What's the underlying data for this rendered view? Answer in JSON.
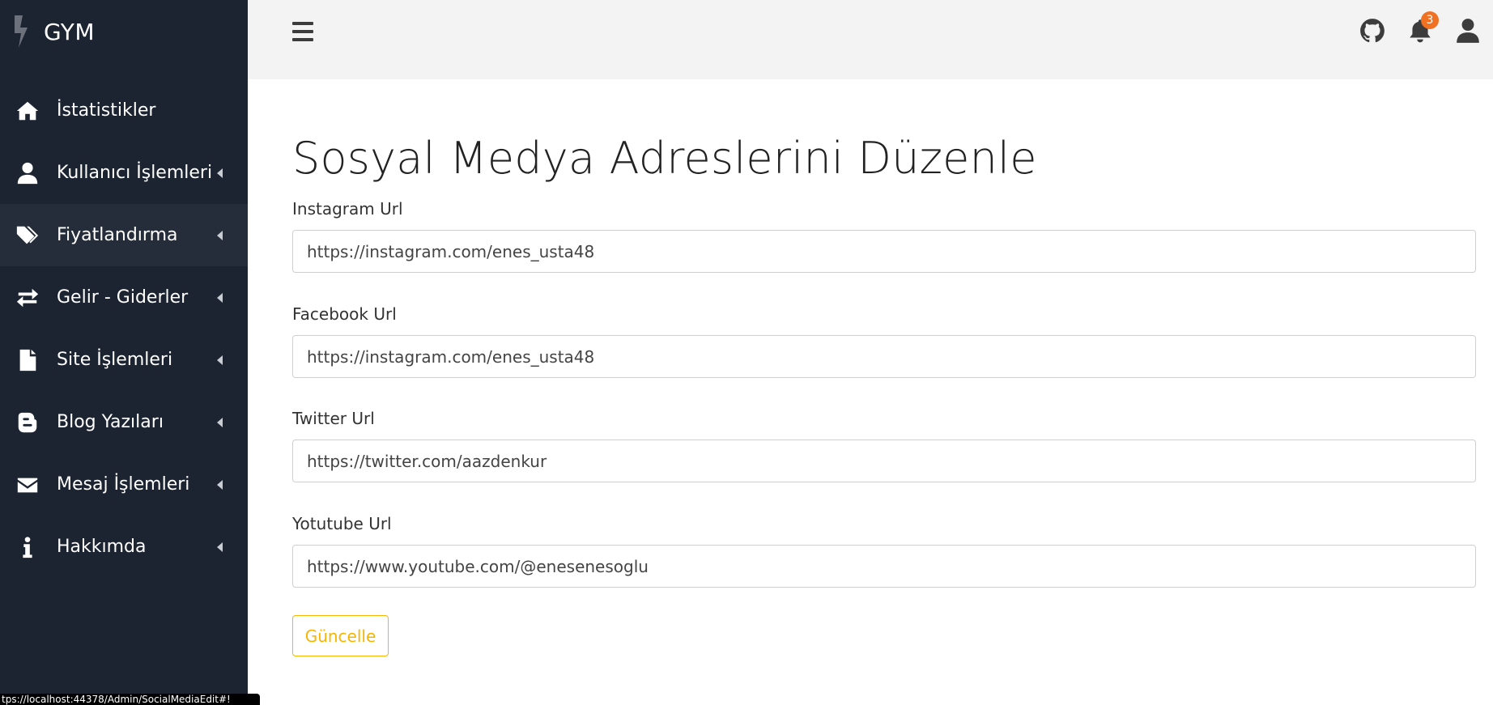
{
  "brand": {
    "name": "GYM",
    "icon": "bolt-icon"
  },
  "sidebar": {
    "items": [
      {
        "label": "İstatistikler",
        "icon": "home-icon",
        "has_caret": false
      },
      {
        "label": "Kullanıcı İşlemleri",
        "icon": "user-icon",
        "has_caret": true
      },
      {
        "label": "Fiyatlandırma",
        "icon": "tags-icon",
        "has_caret": true,
        "active": true
      },
      {
        "label": "Gelir - Giderler",
        "icon": "exchange-icon",
        "has_caret": true
      },
      {
        "label": "Site İşlemleri",
        "icon": "file-icon",
        "has_caret": true
      },
      {
        "label": "Blog Yazıları",
        "icon": "blogger-icon",
        "has_caret": true
      },
      {
        "label": "Mesaj İşlemleri",
        "icon": "envelope-icon",
        "has_caret": true
      },
      {
        "label": "Hakkımda",
        "icon": "info-icon",
        "has_caret": true
      }
    ]
  },
  "topbar": {
    "menu_icon": "hamburger-icon",
    "github_icon": "github-icon",
    "notifications": {
      "icon": "bell-icon",
      "count": "3"
    },
    "user_icon": "user-icon"
  },
  "main": {
    "title": "Sosyal Medya Adreslerini Düzenle",
    "fields": [
      {
        "label": "Instagram Url",
        "value": "https://instagram.com/enes_usta48"
      },
      {
        "label": "Facebook Url",
        "value": "https://instagram.com/enes_usta48"
      },
      {
        "label": "Twitter Url",
        "value": "https://twitter.com/aazdenkur"
      },
      {
        "label": "Yotutube Url",
        "value": "https://www.youtube.com/@enesenesoglu"
      }
    ],
    "submit_label": "Güncelle"
  },
  "statusbar": {
    "text": "tps://localhost:44378/Admin/SocialMediaEdit#!"
  },
  "colors": {
    "sidebar_bg": "#1c2331",
    "accent": "#f7b500",
    "badge": "#f07122",
    "topbar_bg": "#f3f3f3"
  }
}
